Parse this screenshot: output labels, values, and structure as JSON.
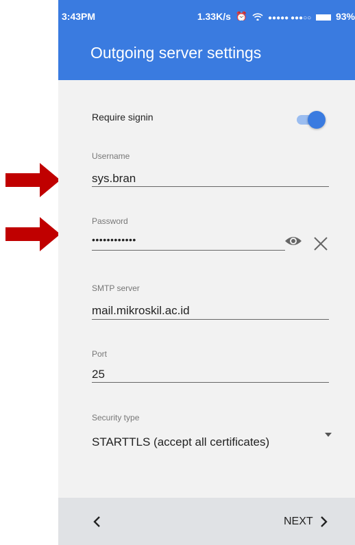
{
  "status": {
    "time": "3:43PM",
    "speed": "1.33K/s",
    "signal": "●●●●● ●●●○○",
    "battery": "93%"
  },
  "appbar": {
    "title": "Outgoing server settings"
  },
  "form": {
    "require_signin": {
      "label": "Require signin",
      "enabled": true
    },
    "username": {
      "label": "Username",
      "value": "sys.bran"
    },
    "password": {
      "label": "Password",
      "value": "••••••••••••"
    },
    "smtp": {
      "label": "SMTP server",
      "value": "mail.mikroskil.ac.id"
    },
    "port": {
      "label": "Port",
      "value": "25"
    },
    "security": {
      "label": "Security type",
      "value": "STARTTLS (accept all certificates)"
    }
  },
  "footer": {
    "next_label": "NEXT"
  },
  "colors": {
    "accent": "#3a7be0",
    "arrow": "#c00000"
  }
}
